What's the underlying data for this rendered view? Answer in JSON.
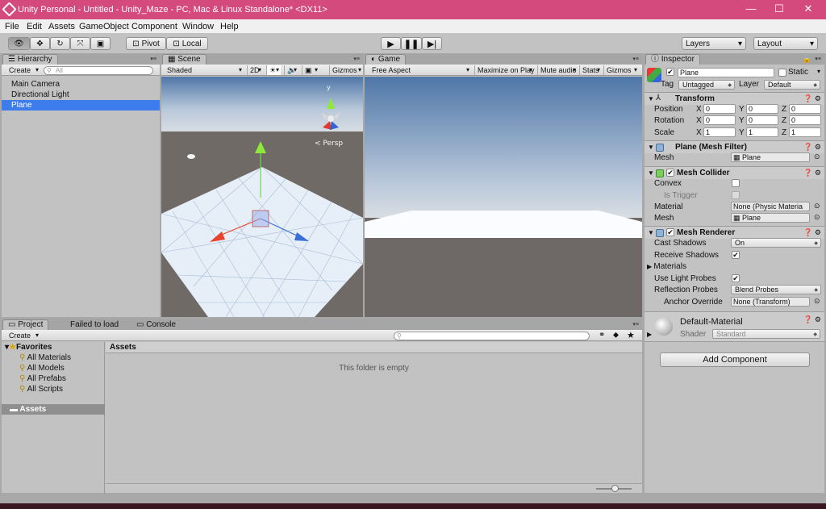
{
  "window": {
    "title": "Unity Personal - Untitled - Unity_Maze - PC, Mac & Linux Standalone* <DX11>",
    "minimize": "—",
    "maximize": "☐",
    "close": "✕"
  },
  "menu": [
    "File",
    "Edit",
    "Assets",
    "GameObject",
    "Component",
    "Window",
    "Help"
  ],
  "toolbar": {
    "pivot": "Pivot",
    "local": "Local",
    "layers": "Layers",
    "layout": "Layout"
  },
  "hierarchy": {
    "tab": "Hierarchy",
    "create": "Create",
    "search": "All",
    "items": [
      "Main Camera",
      "Directional Light",
      "Plane"
    ],
    "selected": "Plane"
  },
  "scene": {
    "tab": "Scene",
    "shading": "Shaded",
    "mode2d": "2D",
    "gizmos": "Gizmos",
    "persp": "< Persp",
    "axis_y": "y"
  },
  "game": {
    "tab": "Game",
    "aspect": "Free Aspect",
    "maximize": "Maximize on Play",
    "mute": "Mute audio",
    "stats": "Stats",
    "gizmos": "Gizmos"
  },
  "project": {
    "tabs": [
      "Project",
      "Failed to load",
      "Console"
    ],
    "create": "Create",
    "favorites": "Favorites",
    "fav_items": [
      "All Materials",
      "All Models",
      "All Prefabs",
      "All Scripts"
    ],
    "assets_folder": "Assets",
    "assets_header": "Assets",
    "empty_msg": "This folder is empty"
  },
  "inspector": {
    "tab": "Inspector",
    "object_name": "Plane",
    "static": "Static",
    "tag_label": "Tag",
    "tag_value": "Untagged",
    "layer_label": "Layer",
    "layer_value": "Default",
    "transform": {
      "title": "Transform",
      "position": {
        "label": "Position",
        "x": "0",
        "y": "0",
        "z": "0"
      },
      "rotation": {
        "label": "Rotation",
        "x": "0",
        "y": "0",
        "z": "0"
      },
      "scale": {
        "label": "Scale",
        "x": "1",
        "y": "1",
        "z": "1"
      }
    },
    "mesh_filter": {
      "title": "Plane (Mesh Filter)",
      "mesh_label": "Mesh",
      "mesh_value": "Plane"
    },
    "mesh_collider": {
      "title": "Mesh Collider",
      "convex": "Convex",
      "is_trigger": "Is Trigger",
      "material_label": "Material",
      "material_value": "None (Physic Materia",
      "mesh_label": "Mesh",
      "mesh_value": "Plane"
    },
    "mesh_renderer": {
      "title": "Mesh Renderer",
      "cast_shadows_label": "Cast Shadows",
      "cast_shadows_value": "On",
      "receive_shadows": "Receive Shadows",
      "materials": "Materials",
      "light_probes": "Use Light Probes",
      "reflection_label": "Reflection Probes",
      "reflection_value": "Blend Probes",
      "anchor_label": "Anchor Override",
      "anchor_value": "None (Transform)"
    },
    "material": {
      "name": "Default-Material",
      "shader_label": "Shader",
      "shader_value": "Standard"
    },
    "add_component": "Add Component"
  },
  "colors": {
    "titlebar": "#d54a7d",
    "selection": "#3d7cec",
    "panel": "#c2c2c2"
  }
}
